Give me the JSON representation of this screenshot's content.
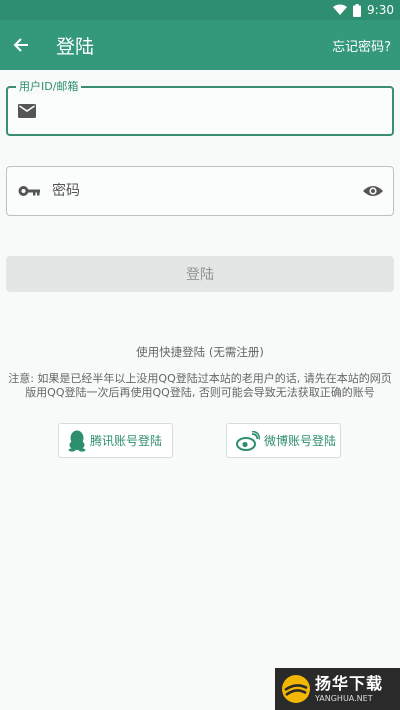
{
  "status_bar": {
    "time": "9:30"
  },
  "app_bar": {
    "title": "登陆",
    "forgot_label": "忘记密码?"
  },
  "form": {
    "user_label": "用户ID/邮箱",
    "user_value": "",
    "password_placeholder": "密码",
    "password_value": "",
    "login_label": "登陆"
  },
  "quick_login": {
    "title": "使用快捷登陆 (无需注册)",
    "notice": "注意: 如果是已经半年以上没用QQ登陆过本站的老用户的话, 请先在本站的网页版用QQ登陆一次后再使用QQ登陆, 否则可能会导致无法获取正确的账号",
    "qq_label": "腾讯账号登陆",
    "weibo_label": "微博账号登陆"
  },
  "watermark": {
    "cn": "扬华下载",
    "en": "YANGHUA.NET"
  },
  "colors": {
    "primary": "#34987a",
    "status_bar": "#2e8f70",
    "focus_border": "#3a8f73",
    "disabled_button": "#e3e6e4",
    "background": "#f7faf8"
  },
  "icons": [
    "wifi-icon",
    "battery-icon",
    "back-arrow-icon",
    "email-icon",
    "key-icon",
    "eye-icon",
    "qq-icon",
    "weibo-icon"
  ]
}
